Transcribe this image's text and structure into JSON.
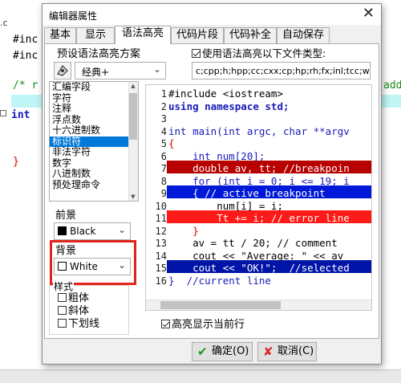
{
  "background_editor": {
    "tab_label": ".c",
    "lines": [
      {
        "text": "#inc"
      },
      {
        "text": "#inc"
      },
      {
        "text": "/* r",
        "right": "add"
      },
      {
        "text": "int"
      },
      {
        "text": "}"
      }
    ]
  },
  "dialog": {
    "title": "编辑器属性",
    "close_glyph": "✕",
    "tabs": [
      "基本",
      "显示",
      "语法高亮",
      "代码片段",
      "代码补全",
      "自动保存"
    ],
    "active_tab": "语法高亮",
    "preset_label": "预设语法高亮方案",
    "preset_value": "经典+",
    "use_highlight_label": "使用语法高亮以下文件类型:",
    "file_types": "c;cpp;h;hpp;cc;cxx;cp;hp;rh;fx;inl;tcc;win;;",
    "categories": [
      "汇编字段",
      "字符",
      "注释",
      "浮点数",
      "十六进制数",
      "标识符",
      "非法字符",
      "数字",
      "八进制数",
      "预处理命令"
    ],
    "selected_category": "标识符",
    "foreground_label": "前景",
    "foreground_value": "Black",
    "background_label": "背景",
    "background_value": "White",
    "style_label": "样式",
    "style_options": [
      "粗体",
      "斜体",
      "下划线"
    ],
    "highlight_current_label": "高亮显示当前行",
    "ok_label": "确定(O)",
    "cancel_label": "取消(C)",
    "colors": {
      "breakpoint": "#b80000",
      "active_breakpoint": "#0018d8",
      "error_line": "#ff1a1a",
      "selected": "#0014a8",
      "current_line_box": "#e0241b"
    }
  },
  "preview": {
    "line_numbers": [
      "1",
      "2",
      "3",
      "4",
      "5",
      "6",
      "7",
      "8",
      "9",
      "10",
      "11",
      "12",
      "13",
      "14",
      "15",
      "16"
    ],
    "lines": [
      {
        "text": "#include <iostream>"
      },
      {
        "text": "using namespace std;"
      },
      {
        "text": ""
      },
      {
        "text": "int main(int argc, char **argv"
      },
      {
        "text": "{"
      },
      {
        "text": "    int num[20];"
      },
      {
        "text": "    double av, tt; //breakpoin"
      },
      {
        "text": "    for (int i = 0; i <= 19; i"
      },
      {
        "text": "    { // active breakpoint"
      },
      {
        "text": "        num[i] = i;"
      },
      {
        "text": "        Tt += i; // error line"
      },
      {
        "text": "    }"
      },
      {
        "text": "    av = tt / 20; // comment"
      },
      {
        "text": "    cout << \"Average: \" << av"
      },
      {
        "text": "    cout << \"OK!\";  //selected"
      },
      {
        "text": "}  //current line"
      }
    ]
  }
}
